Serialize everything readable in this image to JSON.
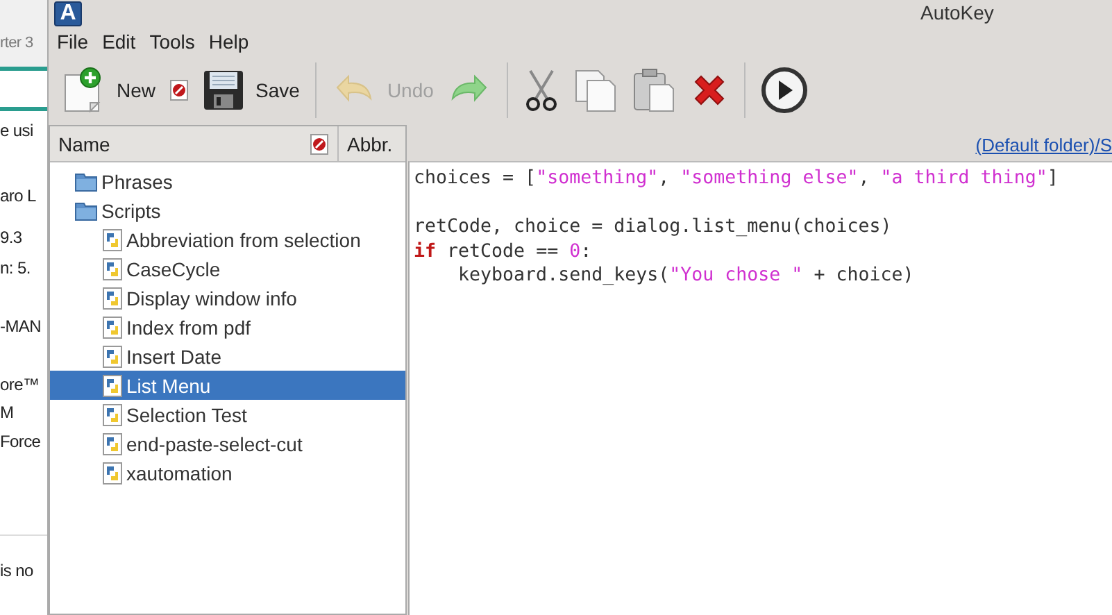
{
  "background_page": {
    "texts": [
      "rter 3",
      "e usi",
      "aro L",
      "9.3",
      "n: 5.",
      "-MAN",
      "ore™",
      "M",
      "Force",
      "is no"
    ]
  },
  "window": {
    "title": "AutoKey",
    "logo_letter": "A"
  },
  "menu": [
    "File",
    "Edit",
    "Tools",
    "Help"
  ],
  "toolbar": [
    {
      "kind": "button",
      "label": "New",
      "disabled": false
    },
    {
      "kind": "icon",
      "disabled": false
    },
    {
      "kind": "button",
      "label": "Save",
      "disabled": false
    },
    {
      "kind": "separator"
    },
    {
      "kind": "button",
      "label": "Undo",
      "disabled": true
    },
    {
      "kind": "icon",
      "disabled": false
    },
    {
      "kind": "separator"
    },
    {
      "kind": "icon",
      "disabled": false
    },
    {
      "kind": "icon",
      "disabled": false
    },
    {
      "kind": "icon",
      "disabled": false
    },
    {
      "kind": "icon",
      "disabled": false
    },
    {
      "kind": "separator"
    },
    {
      "kind": "icon",
      "disabled": false
    }
  ],
  "tree": {
    "columns": [
      "Name",
      "Abbr."
    ],
    "items": [
      {
        "label": "Phrases",
        "kind": "folder",
        "selected": false
      },
      {
        "label": "Scripts",
        "kind": "folder",
        "selected": false,
        "children": [
          {
            "label": "Abbreviation from selection",
            "kind": "script",
            "selected": false
          },
          {
            "label": "CaseCycle",
            "kind": "script",
            "selected": false
          },
          {
            "label": "Display window info",
            "kind": "script",
            "selected": false
          },
          {
            "label": "Index from pdf",
            "kind": "script",
            "selected": false
          },
          {
            "label": "Insert Date",
            "kind": "script",
            "selected": false
          },
          {
            "label": "List Menu",
            "kind": "script",
            "selected": true
          },
          {
            "label": "Selection Test",
            "kind": "script",
            "selected": false
          },
          {
            "label": "end-paste-select-cut",
            "kind": "script",
            "selected": false
          },
          {
            "label": "xautomation",
            "kind": "script",
            "selected": false
          }
        ]
      }
    ]
  },
  "editor": {
    "path_link": "(Default folder)/S",
    "lines": [
      {
        "kind": "code",
        "tokens": [
          {
            "kind": "plain",
            "text": "choices = ["
          },
          {
            "kind": "string",
            "text": "\"something\""
          },
          {
            "kind": "plain",
            "text": ", "
          },
          {
            "kind": "string",
            "text": "\"something else\""
          },
          {
            "kind": "plain",
            "text": ", "
          },
          {
            "kind": "string",
            "text": "\"a third thing\""
          },
          {
            "kind": "plain",
            "text": "]"
          }
        ]
      },
      {
        "kind": "blank"
      },
      {
        "kind": "code",
        "tokens": [
          {
            "kind": "plain",
            "text": "retCode, choice = dialog.list_menu(choices)"
          }
        ]
      },
      {
        "kind": "code",
        "tokens": [
          {
            "kind": "keyword",
            "text": "if"
          },
          {
            "kind": "plain",
            "text": " retCode == "
          },
          {
            "kind": "number",
            "text": "0"
          },
          {
            "kind": "plain",
            "text": ":"
          }
        ]
      },
      {
        "kind": "code",
        "tokens": [
          {
            "kind": "plain",
            "text": "    keyboard.send_keys("
          },
          {
            "kind": "string",
            "text": "\"You chose \""
          },
          {
            "kind": "plain",
            "text": " + choice)"
          }
        ]
      }
    ]
  }
}
